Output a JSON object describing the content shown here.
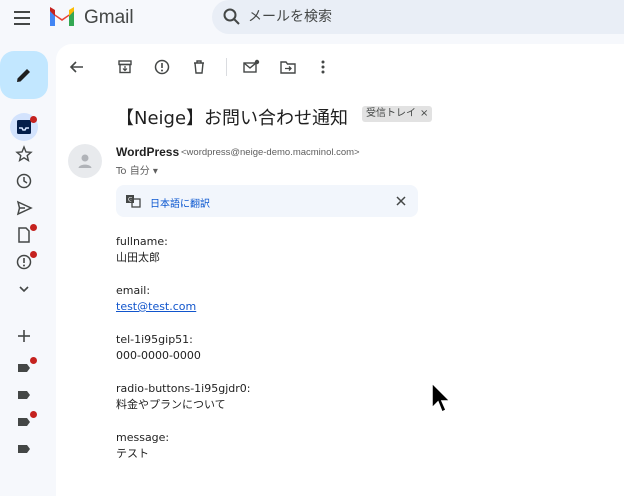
{
  "app": {
    "logo_text": "Gmail"
  },
  "search": {
    "placeholder": "メールを検索"
  },
  "email": {
    "subject": "【Neige】お問い合わせ通知",
    "label": "受信トレイ",
    "label_remove": "×",
    "sender_name": "WordPress",
    "sender_email": "<wordpress@neige-demo.macminol.com>",
    "to_line": "To 自分 ▾",
    "translate_link": "日本語に翻訳",
    "fields": [
      {
        "label": "fullname:",
        "value": "山田太郎",
        "link": false
      },
      {
        "label": "email:",
        "value": "test@test.com",
        "link": true
      },
      {
        "label": "tel-1i95gip51:",
        "value": "000-0000-0000",
        "link": false
      },
      {
        "label": "radio-buttons-1i95gjdr0:",
        "value": "料金やプランについて",
        "link": false
      },
      {
        "label": "message:",
        "value": "テスト",
        "link": false
      }
    ]
  },
  "colors": {
    "accent": "#0b57d0",
    "compose_bg": "#c2e7ff",
    "unread_dot": "#c5221f"
  }
}
